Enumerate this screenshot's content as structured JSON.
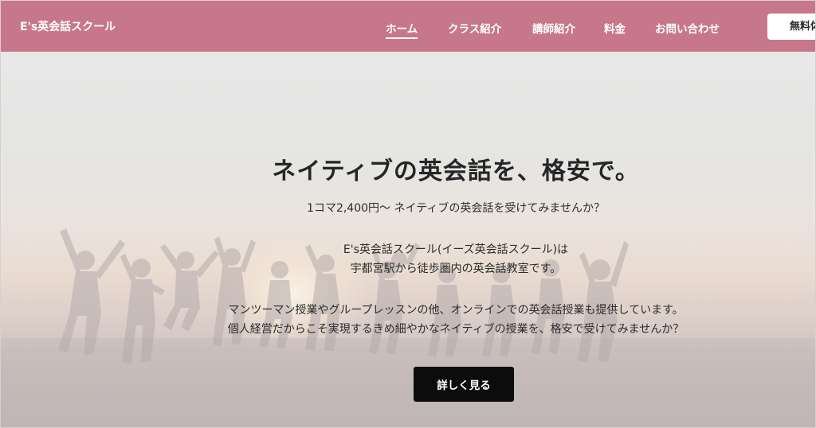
{
  "header": {
    "brand": "E's英会話スクール",
    "nav": [
      {
        "label": "ホーム",
        "active": true
      },
      {
        "label": "クラス紹介",
        "active": false
      },
      {
        "label": "講師紹介",
        "active": false
      },
      {
        "label": "料金",
        "active": false
      },
      {
        "label": "お問い合わせ",
        "active": false
      }
    ],
    "cta_label": "無料体験"
  },
  "hero": {
    "headline": "ネイティブの英会話を、格安で。",
    "subheadline": "1コマ2,400円～ ネイティブの英会話を受けてみませんか？",
    "intro": [
      "E's英会話スクール(イーズ英会話スクール)は",
      "宇都宮駅から徒歩圏内の英会話教室です。"
    ],
    "details": [
      "マンツーマン授業やグループレッスンの他、オンラインでの英会話授業も提供しています。",
      "個人経営だからこそ実現するきめ細やかなネイティブの授業を、格安で受けてみませんか？"
    ],
    "button_label": "詳しく見る"
  },
  "colors": {
    "header_bg": "#c6788a",
    "button_bg": "#0c0c0c",
    "text": "#262626"
  }
}
